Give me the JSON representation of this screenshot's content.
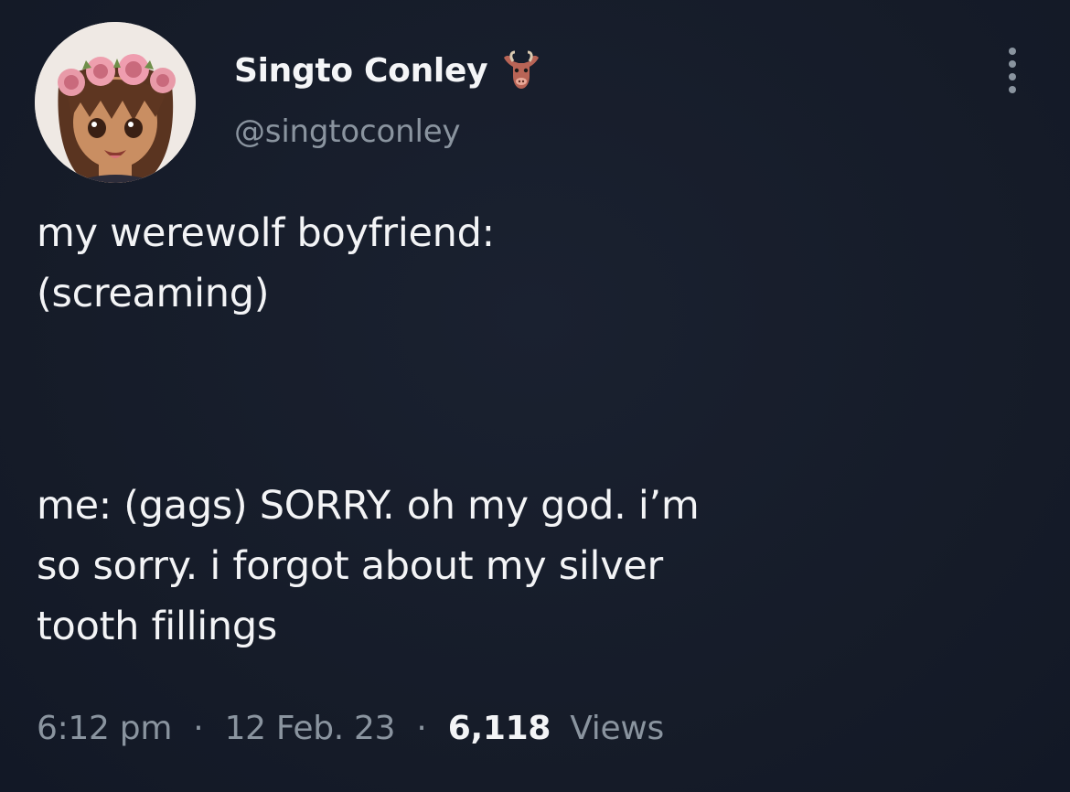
{
  "author": {
    "display_name": "Singto Conley",
    "handle": "@singtoconley",
    "badge_icon": "bull-head-icon",
    "avatar_icon": "anime-character-flower-crown-avatar"
  },
  "more_icon": "more-vertical-icon",
  "tweet": {
    "lines_part1": [
      "my werewolf boyfriend:",
      "(screaming)"
    ],
    "lines_part2": [
      "me: (gags) SORRY. oh my god. i’m",
      "so sorry. i forgot about my silver",
      "tooth fillings"
    ]
  },
  "meta": {
    "time": "6:12 pm",
    "separator": "·",
    "date": "12 Feb. 23",
    "views_count": "6,118",
    "views_label": "Views"
  },
  "colors": {
    "background": "#161c2a",
    "text": "#f3f4f6",
    "secondary_text": "#8a949f"
  }
}
